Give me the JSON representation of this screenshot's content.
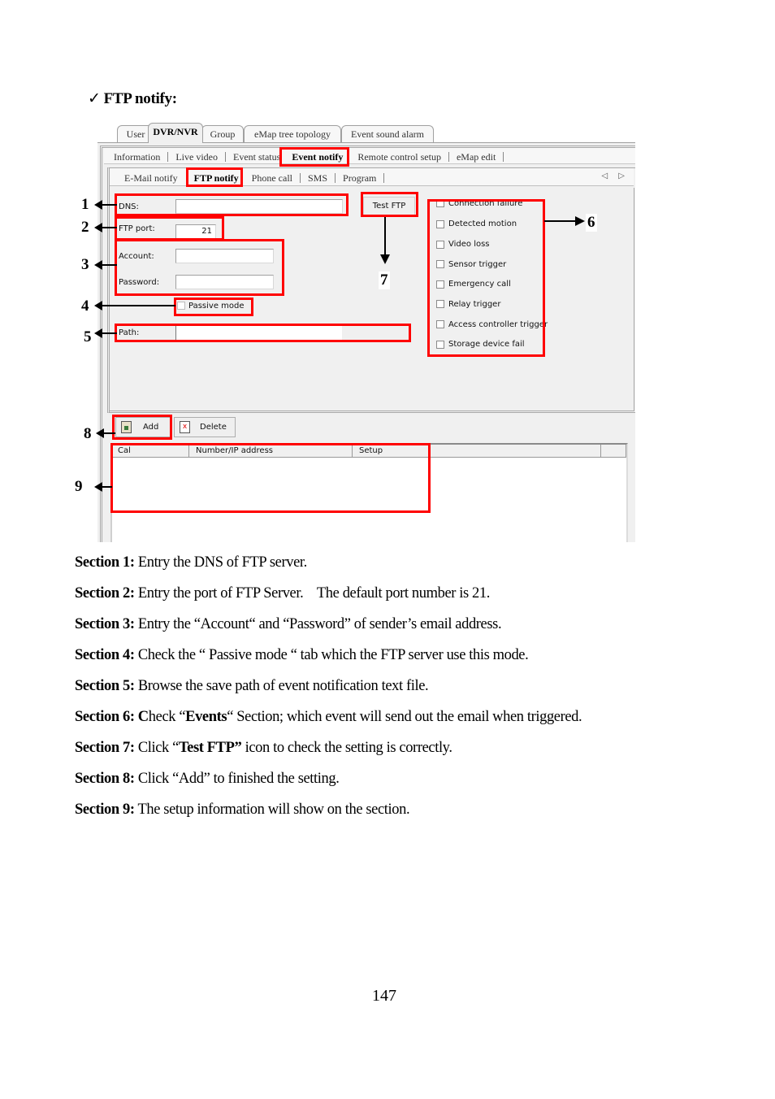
{
  "heading": {
    "check_icon": "✓",
    "title": "FTP notify:"
  },
  "screenshot": {
    "top_tabs": [
      "User",
      "DVR/NVR",
      "Group",
      "eMap tree topology",
      "Event sound alarm"
    ],
    "top_tab_active": "DVR/NVR",
    "level2_tabs": [
      "Information",
      "Live video",
      "Event status",
      "Event notify",
      "Remote control setup",
      "eMap edit"
    ],
    "level2_active": "Event notify",
    "level3_tabs": [
      "E-Mail notify",
      "FTP notify",
      "Phone call",
      "SMS",
      "Program"
    ],
    "level3_active": "FTP notify",
    "scroll_arrows": "◁ ▷",
    "form": {
      "dns_label": "DNS:",
      "dns_value": "",
      "ftp_port_label": "FTP port:",
      "ftp_port_value": "21",
      "account_label": "Account:",
      "account_value": "",
      "password_label": "Password:",
      "password_value": "",
      "passive_mode_label": "Passive mode",
      "passive_mode_checked": false,
      "path_label": "Path:",
      "path_value": "",
      "test_ftp_label": "Test FTP"
    },
    "events": [
      {
        "label": "Connection failure",
        "checked": false
      },
      {
        "label": "Detected motion",
        "checked": false
      },
      {
        "label": "Video loss",
        "checked": false
      },
      {
        "label": "Sensor trigger",
        "checked": false
      },
      {
        "label": "Emergency call",
        "checked": false
      },
      {
        "label": "Relay trigger",
        "checked": false
      },
      {
        "label": "Access controller trigger",
        "checked": false
      },
      {
        "label": "Storage device fail",
        "checked": false
      }
    ],
    "toolbar": {
      "add_label": "Add",
      "delete_label": "Delete"
    },
    "list": {
      "columns": [
        "Cal",
        "Number/IP address",
        "Setup"
      ],
      "rows": []
    },
    "annotations": [
      "1",
      "2",
      "3",
      "4",
      "5",
      "6",
      "7",
      "8",
      "9"
    ],
    "highlight_color": "#ff0000"
  },
  "sections": [
    {
      "label": "Section 1:",
      "text": " Entry the DNS of FTP server."
    },
    {
      "label": "Section 2:",
      "text": " Entry the port of FTP Server.    The default port number is 21."
    },
    {
      "label": "Section 3:",
      "text": " Entry the “Account“ and “Password” of sender’s email address."
    },
    {
      "label": "Section 4:",
      "text": " Check the “ Passive mode “ tab which the FTP server use this mode."
    },
    {
      "label": "Section 5:",
      "text": " Browse the save path of event notification text file."
    },
    {
      "label": "Section 6: C",
      "text_pre": "heck “",
      "bold_word": "Events",
      "text": "“ Section; which event will send out the email when triggered."
    },
    {
      "label": "Section 7:",
      "text_pre": " Click “",
      "bold_word": "Test FTP”",
      "text": " icon to check the setting is correctly."
    },
    {
      "label": "Section 8:",
      "text": " Click “Add” to finished the setting."
    },
    {
      "label": "Section 9:",
      "text": " The setup information will show on the section."
    }
  ],
  "page_number": "147"
}
